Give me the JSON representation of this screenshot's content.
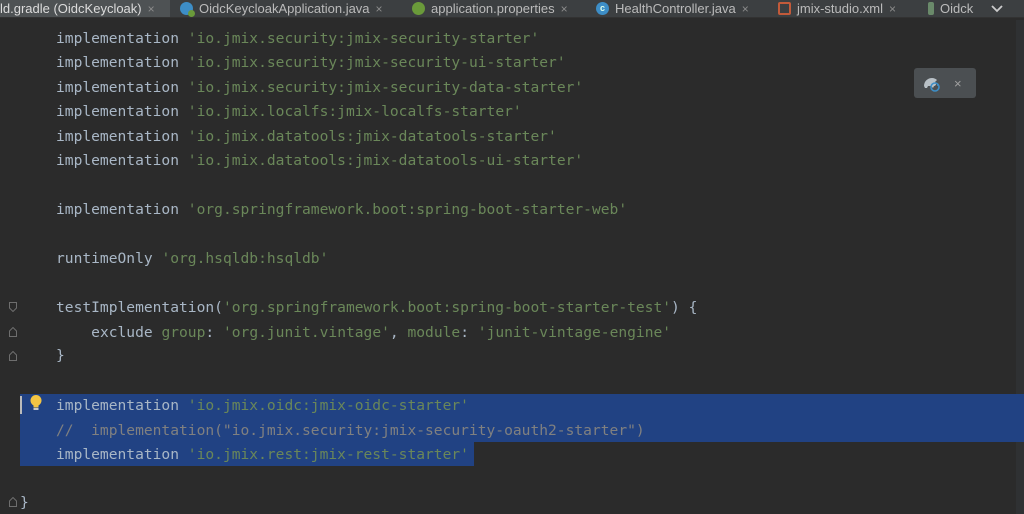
{
  "tabs": [
    {
      "label": "ld.gradle (OidcKeycloak)",
      "icon": "gradle-icon",
      "close": "×",
      "active": true
    },
    {
      "label": "OidcKeycloakApplication.java",
      "icon": "spring-boot-java-icon",
      "close": "×",
      "active": false
    },
    {
      "label": "application.properties",
      "icon": "properties-icon",
      "close": "×",
      "active": false
    },
    {
      "label": "HealthController.java",
      "icon": "class-icon",
      "close": "×",
      "active": false
    },
    {
      "label": "jmix-studio.xml",
      "icon": "xml-icon",
      "close": "×",
      "active": false
    },
    {
      "label": "Oidck",
      "icon": "none",
      "close": "",
      "active": false
    }
  ],
  "code": {
    "l1": {
      "kw": "implementation ",
      "str": "'io.jmix.security:jmix-security-starter'"
    },
    "l2": {
      "kw": "implementation ",
      "str": "'io.jmix.security:jmix-security-ui-starter'"
    },
    "l3": {
      "kw": "implementation ",
      "str": "'io.jmix.security:jmix-security-data-starter'"
    },
    "l4": {
      "kw": "implementation ",
      "str": "'io.jmix.localfs:jmix-localfs-starter'"
    },
    "l5": {
      "kw": "implementation ",
      "str": "'io.jmix.datatools:jmix-datatools-starter'"
    },
    "l6": {
      "kw": "implementation ",
      "str": "'io.jmix.datatools:jmix-datatools-ui-starter'"
    },
    "l7": {
      "kw": "implementation ",
      "str": "'org.springframework.boot:spring-boot-starter-web'"
    },
    "l8": {
      "kw": "runtimeOnly ",
      "str": "'org.hsqldb:hsqldb'"
    },
    "l9": {
      "kw": "testImplementation(",
      "str": "'org.springframework.boot:spring-boot-starter-test'",
      "tail": ") {"
    },
    "l10": {
      "indent": "    ",
      "kw": "exclude ",
      "k1": "group",
      "p1": ": ",
      "s1": "'org.junit.vintage'",
      "p2": ", ",
      "k2": "module",
      "p3": ": ",
      "s2": "'junit-vintage-engine'"
    },
    "l11": {
      "text": "}"
    },
    "l12": {
      "kw": "implementation ",
      "str": "'io.jmix.oidc:jmix-oidc-starter'"
    },
    "l13": {
      "comment": "//  implementation(\"io.jmix.security:jmix-security-oauth2-starter\")"
    },
    "l14": {
      "kw": "implementation ",
      "str": "'io.jmix.rest:jmix-rest-starter'"
    },
    "l15": {
      "text": "}"
    }
  },
  "popup": {
    "icon": "gradle-reload-icon",
    "close": "×"
  },
  "chevron_icon": "chevron-down-icon",
  "intention_icon": "lightbulb-icon",
  "colors": {
    "selection": "#214283",
    "string": "#6a8759",
    "comment": "#808080",
    "text": "#a9b7c6",
    "background": "#2b2b2b"
  }
}
